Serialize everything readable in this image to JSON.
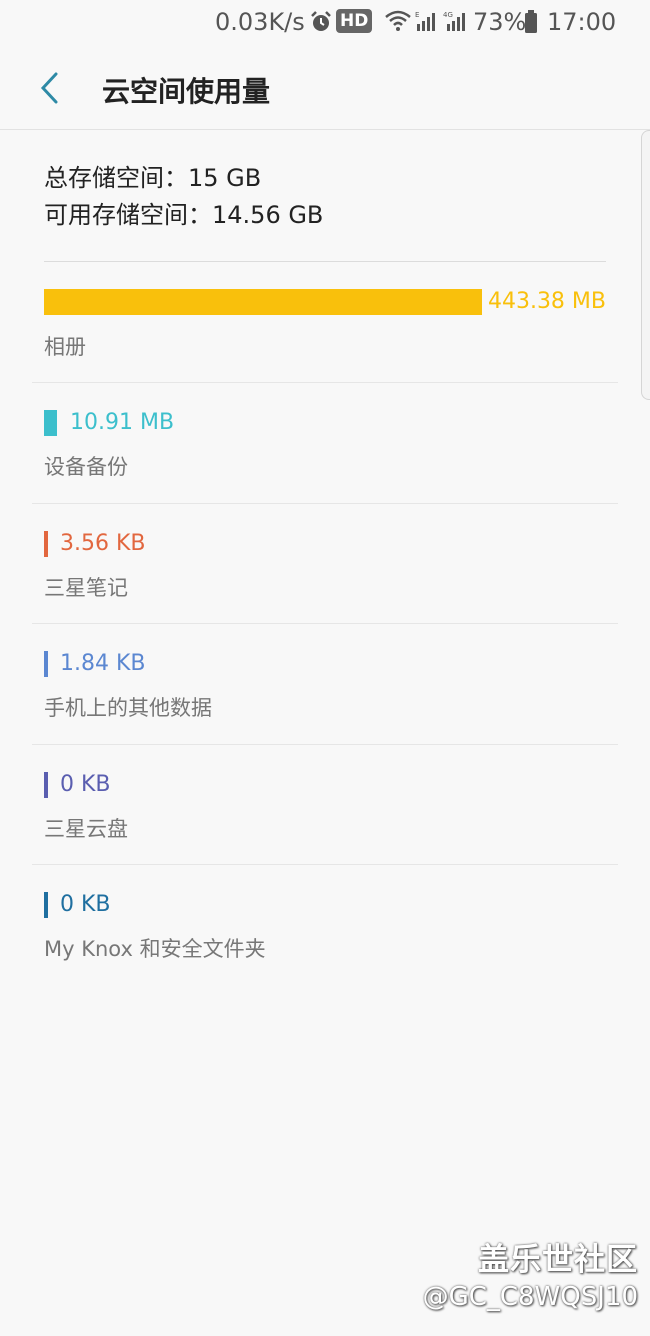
{
  "status_bar": {
    "net_speed": "0.03K/s",
    "hd": "HD",
    "battery": "73%",
    "time": "17:00",
    "icons": [
      "alarm-icon",
      "wifi-icon",
      "signal-icon",
      "signal-4g-icon",
      "battery-icon"
    ]
  },
  "header": {
    "back_icon": "chevron-left-icon",
    "title": "云空间使用量"
  },
  "summary": {
    "total_label": "总存储空间：",
    "total_value": "15 GB",
    "available_label": "可用存储空间：",
    "available_value": "14.56 GB"
  },
  "usage_items": [
    {
      "size": "443.38 MB",
      "label": "相册",
      "color": "#f9c00c",
      "fill_fraction": 0.78
    },
    {
      "size": "10.91 MB",
      "label": "设备备份",
      "color": "#3cbfcc"
    },
    {
      "size": "3.56 KB",
      "label": "三星笔记",
      "color": "#e2673f"
    },
    {
      "size": "1.84 KB",
      "label": "手机上的其他数据",
      "color": "#5b87d1"
    },
    {
      "size": "0 KB",
      "label": "三星云盘",
      "color": "#5a5eb0"
    },
    {
      "size": "0 KB",
      "label": "My Knox 和安全文件夹",
      "color": "#1f6fa0"
    }
  ],
  "watermark": {
    "site": "盖乐世社区",
    "user": "@GC_C8WQSJ10"
  }
}
